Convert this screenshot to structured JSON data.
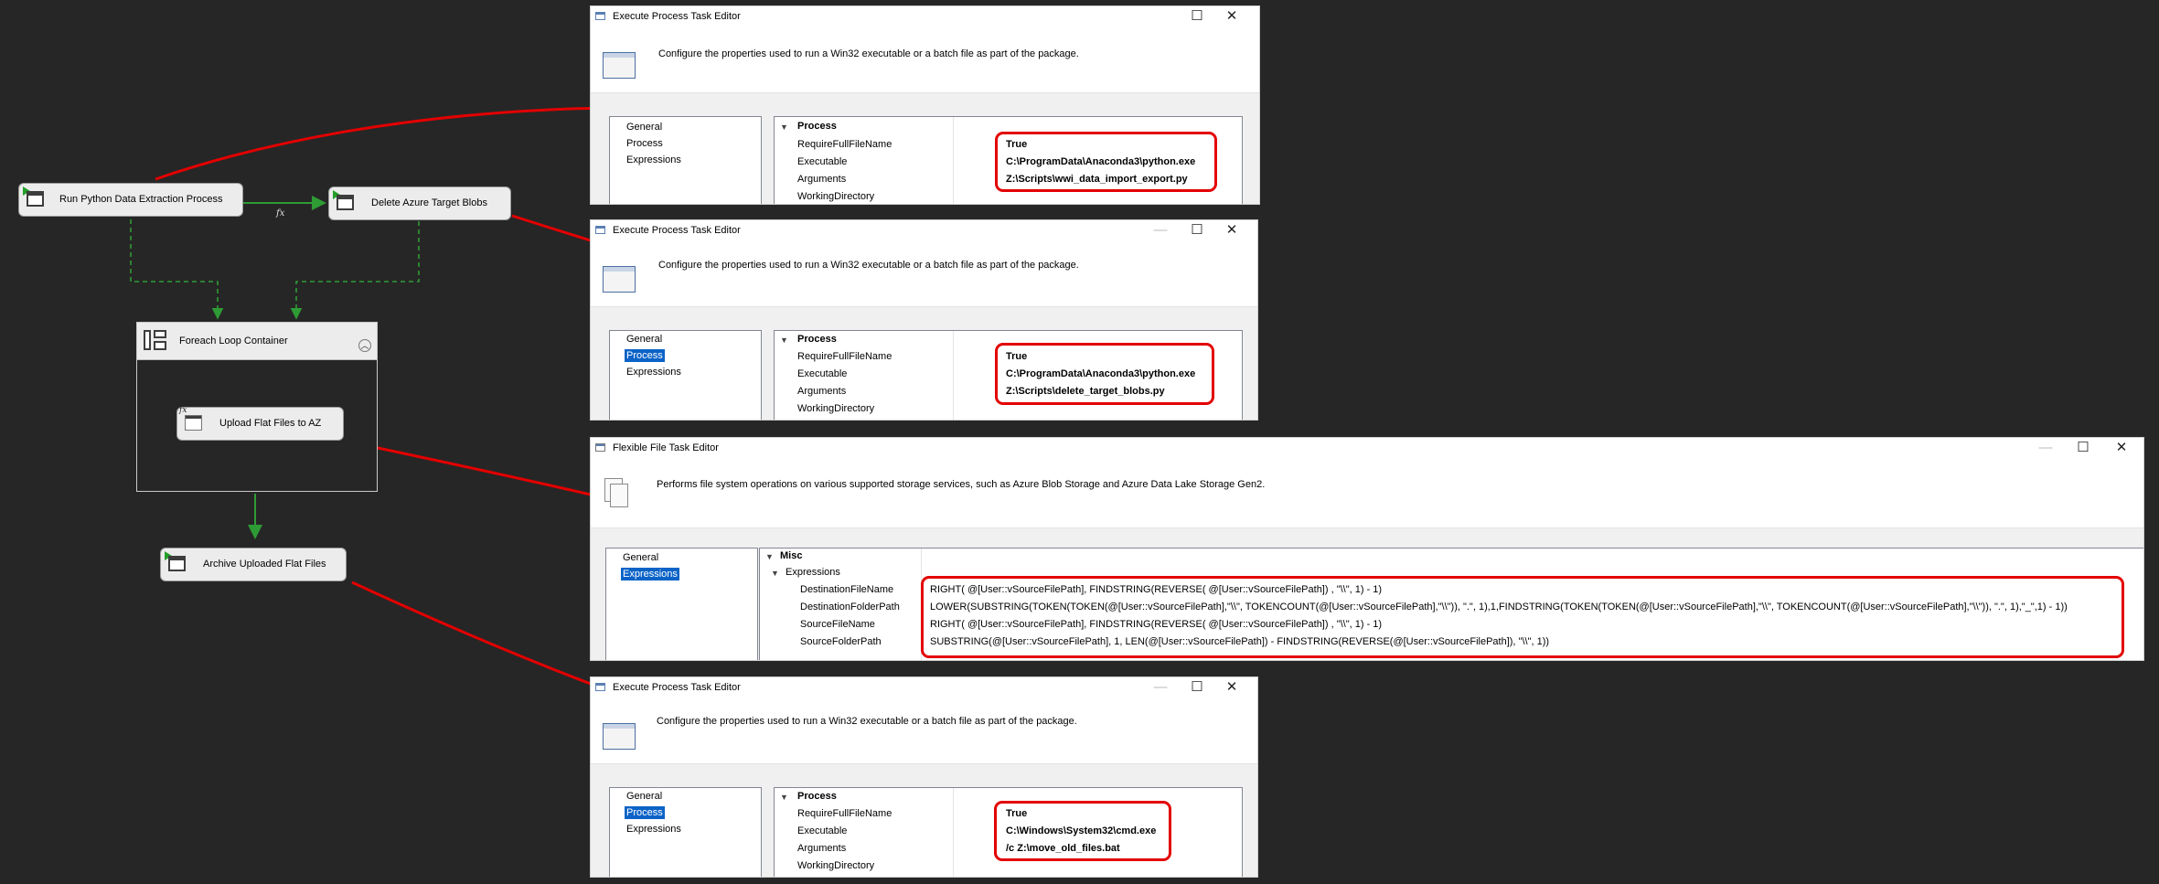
{
  "flow": {
    "tasks": [
      {
        "label": "Run Python Data Extraction Process"
      },
      {
        "label": "Delete Azure Target Blobs"
      },
      {
        "label": "Upload Flat Files to AZ"
      },
      {
        "label": "Archive Uploaded Flat Files"
      }
    ],
    "container_label": "Foreach Loop Container",
    "expression_badge": "fx"
  },
  "dialogs": {
    "d1": {
      "title": "Execute Process Task Editor",
      "description": "Configure the properties used to run a Win32 executable or a batch file as part of the package.",
      "nav": [
        "General",
        "Process",
        "Expressions"
      ],
      "category": "Process",
      "rows": [
        {
          "name": "RequireFullFileName",
          "value": "True"
        },
        {
          "name": "Executable",
          "value": "C:\\ProgramData\\Anaconda3\\python.exe"
        },
        {
          "name": "Arguments",
          "value": "Z:\\Scripts\\wwi_data_import_export.py"
        },
        {
          "name": "WorkingDirectory",
          "value": ""
        }
      ]
    },
    "d2": {
      "title": "Execute Process Task Editor",
      "description": "Configure the properties used to run a Win32 executable or a batch file as part of the package.",
      "nav": [
        "General",
        "Process",
        "Expressions"
      ],
      "category": "Process",
      "rows": [
        {
          "name": "RequireFullFileName",
          "value": "True"
        },
        {
          "name": "Executable",
          "value": "C:\\ProgramData\\Anaconda3\\python.exe"
        },
        {
          "name": "Arguments",
          "value": "Z:\\Scripts\\delete_target_blobs.py"
        },
        {
          "name": "WorkingDirectory",
          "value": ""
        }
      ]
    },
    "d3": {
      "title": "Flexible File Task Editor",
      "description": "Performs file system operations on various supported storage services, such as Azure Blob Storage and Azure Data Lake Storage Gen2.",
      "nav": [
        "General",
        "Expressions"
      ],
      "category_misc": "Misc",
      "category": "Expressions",
      "rows": [
        {
          "name": "DestinationFileName",
          "value": "RIGHT( @[User::vSourceFilePath], FINDSTRING(REVERSE( @[User::vSourceFilePath]) , \"\\\\\", 1) - 1)"
        },
        {
          "name": "DestinationFolderPath",
          "value": "LOWER(SUBSTRING(TOKEN(TOKEN(@[User::vSourceFilePath],\"\\\\\", TOKENCOUNT(@[User::vSourceFilePath],\"\\\\\")), \".\", 1),1,FINDSTRING(TOKEN(TOKEN(@[User::vSourceFilePath],\"\\\\\", TOKENCOUNT(@[User::vSourceFilePath],\"\\\\\")), \".\", 1),\"_\",1) - 1))"
        },
        {
          "name": "SourceFileName",
          "value": "RIGHT( @[User::vSourceFilePath], FINDSTRING(REVERSE( @[User::vSourceFilePath]) , \"\\\\\", 1) - 1)"
        },
        {
          "name": "SourceFolderPath",
          "value": "SUBSTRING(@[User::vSourceFilePath], 1,   LEN(@[User::vSourceFilePath]) - FINDSTRING(REVERSE(@[User::vSourceFilePath]), \"\\\\\", 1))"
        }
      ]
    },
    "d4": {
      "title": "Execute Process Task Editor",
      "description": "Configure the properties used to run a Win32 executable or a batch file as part of the package.",
      "nav": [
        "General",
        "Process",
        "Expressions"
      ],
      "category": "Process",
      "rows": [
        {
          "name": "RequireFullFileName",
          "value": "True"
        },
        {
          "name": "Executable",
          "value": "C:\\Windows\\System32\\cmd.exe"
        },
        {
          "name": "Arguments",
          "value": "/c Z:\\move_old_files.bat"
        },
        {
          "name": "WorkingDirectory",
          "value": ""
        }
      ]
    }
  },
  "window_controls": {
    "minimize": "—",
    "maximize": "☐",
    "close": "✕"
  },
  "colors": {
    "canvas": "#262626",
    "highlight": "#e30000",
    "precedence_green": "#2e9b35",
    "selection": "#0b63c7"
  }
}
